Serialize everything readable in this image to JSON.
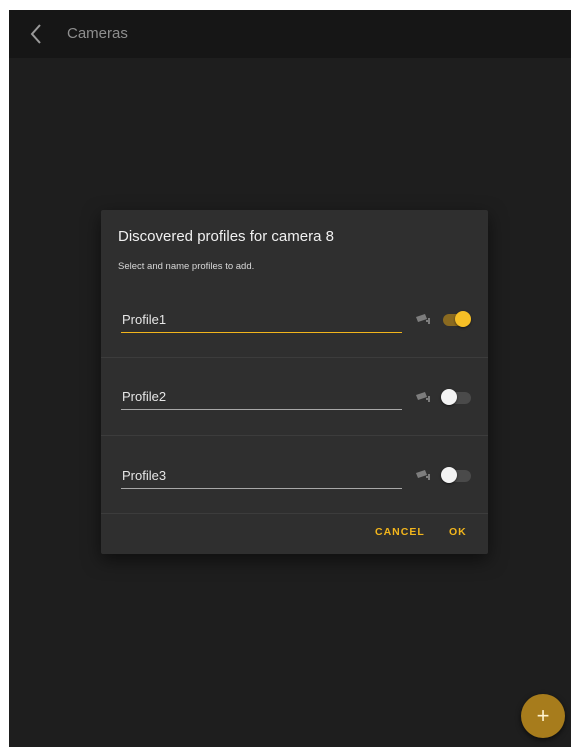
{
  "appbar": {
    "title": "Cameras",
    "back_icon": "chevron-left-icon"
  },
  "dialog": {
    "title": "Discovered profiles for camera 8",
    "subtitle": "Select and name profiles to add.",
    "profiles": [
      {
        "name": "Profile1",
        "enabled": true,
        "camera_icon": "cctv-camera-icon"
      },
      {
        "name": "Profile2",
        "enabled": false,
        "camera_icon": "cctv-camera-icon"
      },
      {
        "name": "Profile3",
        "enabled": false,
        "camera_icon": "cctv-camera-icon"
      }
    ],
    "cancel_label": "CANCEL",
    "ok_label": "OK"
  },
  "fab": {
    "label": "+",
    "icon": "plus-icon"
  },
  "colors": {
    "accent": "#f2b51c",
    "background": "#1e1e1e",
    "dialog": "#2f2f2f"
  }
}
